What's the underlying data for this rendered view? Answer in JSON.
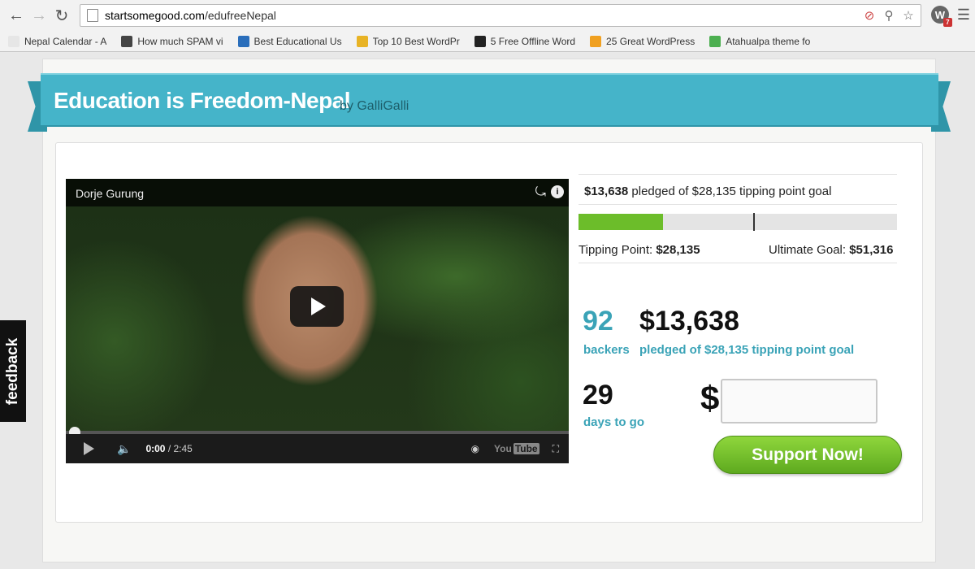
{
  "browser": {
    "url_host": "startsomegood.com",
    "url_path": "/edufreeNepal",
    "bookmarks": [
      {
        "label": "Nepal Calendar - A",
        "icon_color": "#e6e6e6"
      },
      {
        "label": "How much SPAM vi",
        "icon_color": "#444444"
      },
      {
        "label": "Best Educational Us",
        "icon_color": "#2a6ebb"
      },
      {
        "label": "Top 10 Best WordPr",
        "icon_color": "#e8b325"
      },
      {
        "label": "5 Free Offline Word",
        "icon_color": "#222222"
      },
      {
        "label": "25 Great WordPress",
        "icon_color": "#f0a020"
      },
      {
        "label": "Atahualpa theme fo",
        "icon_color": "#4caf50"
      }
    ]
  },
  "campaign": {
    "title": "Education is Freedom-Nepal",
    "byline": "by GalliGalli"
  },
  "video": {
    "title": "Dorje Gurung",
    "time_current": "0:00",
    "time_total": "/ 2:45",
    "youtube_label": "You",
    "youtube_label_box": "Tube"
  },
  "stats": {
    "pledged_amount": "$13,638",
    "pledged_text": " pledged of $28,135 tipping point goal",
    "progress_fraction": 0.266,
    "tipping_marker_fraction": 0.548,
    "tipping_label": "Tipping Point: ",
    "tipping_value": "$28,135",
    "ultimate_label": "Ultimate Goal: ",
    "ultimate_value": "$51,316",
    "backers_count": "92",
    "backers_label": "backers",
    "amount_big": "$13,638",
    "amount_label": "pledged of $28,135 tipping point goal",
    "days_count": "29",
    "days_label": "days to go"
  },
  "pledge": {
    "currency": "$",
    "input_value": "",
    "button_label": "Support Now!"
  },
  "feedback_label": "feedback",
  "colors": {
    "ribbon": "#45b4c9",
    "accent_teal": "#3aa3b7",
    "progress_green": "#6cbd2a",
    "button_green": "#5eaa1f"
  }
}
